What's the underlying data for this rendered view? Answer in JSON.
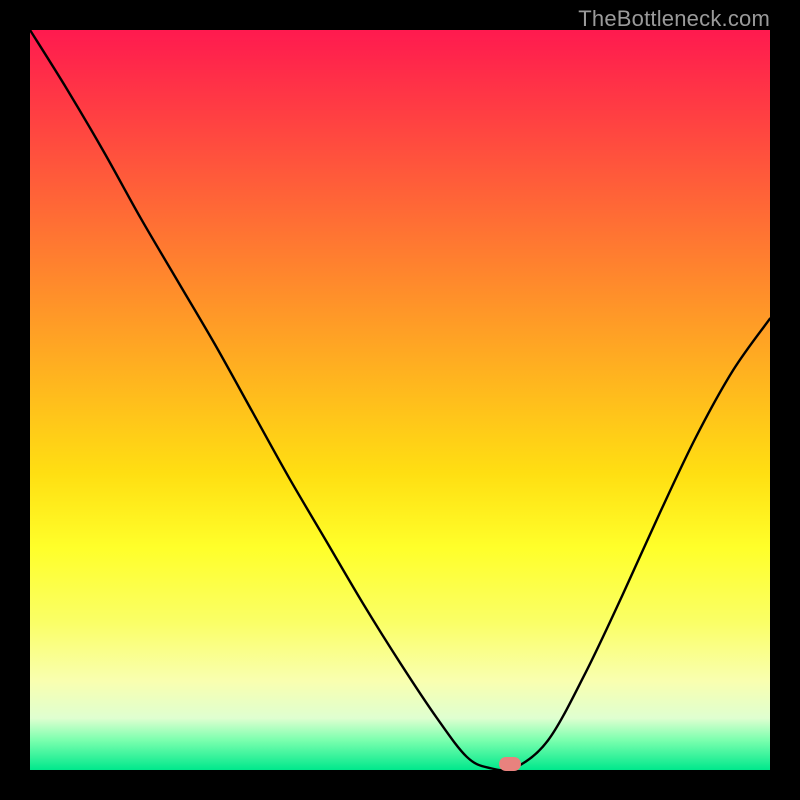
{
  "watermark": "TheBottleneck.com",
  "marker": {
    "cx_frac": 0.648,
    "cy_frac": 0.992
  },
  "chart_data": {
    "type": "line",
    "title": "",
    "xlabel": "",
    "ylabel": "",
    "xlim": [
      0,
      1
    ],
    "ylim": [
      0,
      1
    ],
    "x": [
      0.0,
      0.05,
      0.1,
      0.15,
      0.2,
      0.25,
      0.3,
      0.35,
      0.4,
      0.45,
      0.5,
      0.55,
      0.59,
      0.62,
      0.655,
      0.7,
      0.75,
      0.8,
      0.85,
      0.9,
      0.95,
      1.0
    ],
    "values": [
      1.0,
      0.92,
      0.835,
      0.745,
      0.66,
      0.575,
      0.485,
      0.395,
      0.31,
      0.225,
      0.145,
      0.07,
      0.018,
      0.003,
      0.003,
      0.04,
      0.13,
      0.235,
      0.345,
      0.45,
      0.54,
      0.61
    ],
    "series": [
      {
        "name": "bottleneck-curve",
        "x": [
          0.0,
          0.05,
          0.1,
          0.15,
          0.2,
          0.25,
          0.3,
          0.35,
          0.4,
          0.45,
          0.5,
          0.55,
          0.59,
          0.62,
          0.655,
          0.7,
          0.75,
          0.8,
          0.85,
          0.9,
          0.95,
          1.0
        ],
        "values": [
          1.0,
          0.92,
          0.835,
          0.745,
          0.66,
          0.575,
          0.485,
          0.395,
          0.31,
          0.225,
          0.145,
          0.07,
          0.018,
          0.003,
          0.003,
          0.04,
          0.13,
          0.235,
          0.345,
          0.45,
          0.54,
          0.61
        ]
      }
    ],
    "annotations": [
      {
        "name": "optimum-marker",
        "x": 0.648,
        "y": 0.008
      }
    ]
  }
}
